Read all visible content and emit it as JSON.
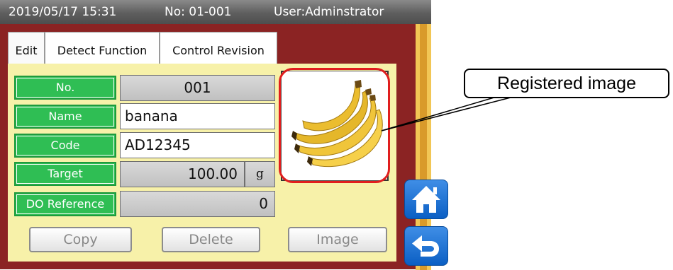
{
  "status_bar": {
    "datetime": "2019/05/17 15:31",
    "number": "No: 01-001",
    "user": "User:Adminstrator"
  },
  "tabs": [
    {
      "label": "Edit",
      "active": true
    },
    {
      "label": "Detect Function",
      "active": false
    },
    {
      "label": "Control Revision",
      "active": false
    }
  ],
  "form": {
    "no": {
      "label": "No.",
      "value": "001"
    },
    "name": {
      "label": "Name",
      "value": "banana"
    },
    "code": {
      "label": "Code",
      "value": "AD12345"
    },
    "target": {
      "label": "Target",
      "value": "100.00",
      "unit": "g"
    },
    "do_ref": {
      "label": "DO Reference",
      "value": "0"
    }
  },
  "registered_image": {
    "subject": "banana-bunch"
  },
  "buttons": {
    "copy": "Copy",
    "delete": "Delete",
    "image": "Image"
  },
  "nav": {
    "home_icon": "home-icon",
    "back_icon": "back-arrow-icon"
  },
  "callout": {
    "text": "Registered image"
  },
  "colors": {
    "frame": "#8b2323",
    "panel": "#f7f1a9",
    "label_green": "#2fbe54",
    "stripe_gold": "#e9b43a",
    "nav_blue": "#1f73d6",
    "highlight_red": "#e01e1e"
  }
}
